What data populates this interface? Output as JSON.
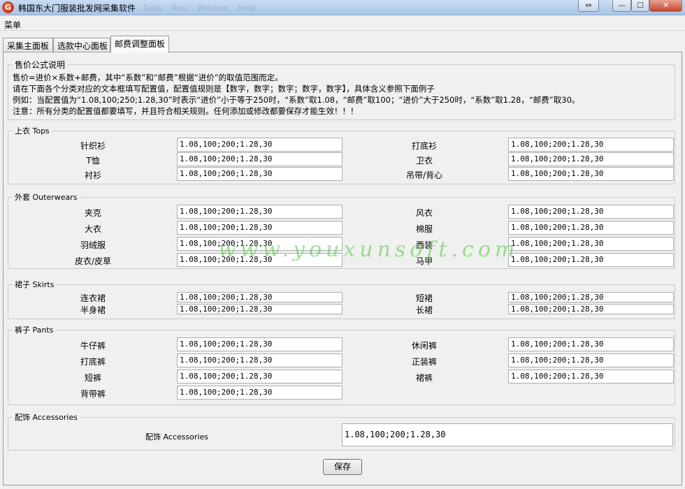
{
  "window": {
    "title": "韩国东大门服装批发网采集软件",
    "ghost_menu": [
      "Data",
      "Run",
      "Window",
      "Help"
    ],
    "buttons": {
      "restore": "⇔",
      "minimize": "—",
      "maximize": "☐",
      "close": "✕"
    }
  },
  "menubar": {
    "menu_label": "菜单"
  },
  "tabs": [
    "采集主面板",
    "选款中心面板",
    "邮费调整面板"
  ],
  "active_tab": 2,
  "formula": {
    "title": "售价公式说明",
    "lines": [
      "售价=进价×系数+邮费，其中“系数”和“邮费”根据“进价”的取值范围而定。",
      "请在下面各个分类对应的文本框填写配置值，配置值规则是【数字，数字；数字；数字，数字】，具体含义参照下面例子",
      "例如：当配置值为“1.08,100;250;1.28,30”时表示“进价”小于等于250时，“系数”取1.08，“邮费”取100；“进价”大于250时，“系数”取1.28，“邮费”取30。",
      "注意：所有分类的配置值都要填写，并且符合相关规则。任何添加或修改都要保存才能生效！！！"
    ]
  },
  "groups": {
    "tops": {
      "title": "上衣 Tops",
      "items": [
        {
          "label": "针织衫",
          "value": "1.08,100;200;1.28,30"
        },
        {
          "label": "打底衫",
          "value": "1.08,100;200;1.28,30"
        },
        {
          "label": "T恤",
          "value": "1.08,100;200;1.28,30"
        },
        {
          "label": "卫衣",
          "value": "1.08,100;200;1.28,30"
        },
        {
          "label": "衬衫",
          "value": "1.08,100;200;1.28,30"
        },
        {
          "label": "吊带/背心",
          "value": "1.08,100;200;1.28,30"
        }
      ]
    },
    "outerwears": {
      "title": "外套 Outerwears",
      "items": [
        {
          "label": "夹克",
          "value": "1.08,100;200;1.28,30"
        },
        {
          "label": "风衣",
          "value": "1.08,100;200;1.28,30"
        },
        {
          "label": "大衣",
          "value": "1.08,100;200;1.28,30"
        },
        {
          "label": "棉服",
          "value": "1.08,100;200;1.28,30"
        },
        {
          "label": "羽绒服",
          "value": "1.08,100;200;1.28,30"
        },
        {
          "label": "西装",
          "value": "1.08,100;200;1.28,30"
        },
        {
          "label": "皮衣/皮草",
          "value": "1.08,100;200;1.28,30"
        },
        {
          "label": "马甲",
          "value": "1.08,100;200;1.28,30"
        }
      ]
    },
    "skirts": {
      "title": "裙子 Skirts",
      "items": [
        {
          "label": "连衣裙",
          "value": "1.08,100;200;1.28,30"
        },
        {
          "label": "短裙",
          "value": "1.08,100;200;1.28,30"
        },
        {
          "label": "半身裙",
          "value": "1.08,100;200;1.28,30"
        },
        {
          "label": "长裙",
          "value": "1.08,100;200;1.28,30"
        }
      ]
    },
    "pants": {
      "title": "裤子 Pants",
      "items": [
        {
          "label": "牛仔裤",
          "value": "1.08,100;200;1.28,30"
        },
        {
          "label": "休闲裤",
          "value": "1.08,100;200;1.28,30"
        },
        {
          "label": "打底裤",
          "value": "1.08,100;200;1.28,30"
        },
        {
          "label": "正装裤",
          "value": "1.08,100;200;1.28,30"
        },
        {
          "label": "短裤",
          "value": "1.08,100;200;1.28,30"
        },
        {
          "label": "裙裤",
          "value": "1.08,100;200;1.28,30"
        },
        {
          "label": "背带裤",
          "value": "1.08,100;200;1.28,30"
        }
      ]
    },
    "accessories": {
      "title": "配饰 Accessories",
      "items": [
        {
          "label": "配饰 Accessories",
          "value": "1.08,100;200;1.28,30"
        }
      ]
    }
  },
  "watermark": "www.youxunsoft.com",
  "save_label": "保存"
}
